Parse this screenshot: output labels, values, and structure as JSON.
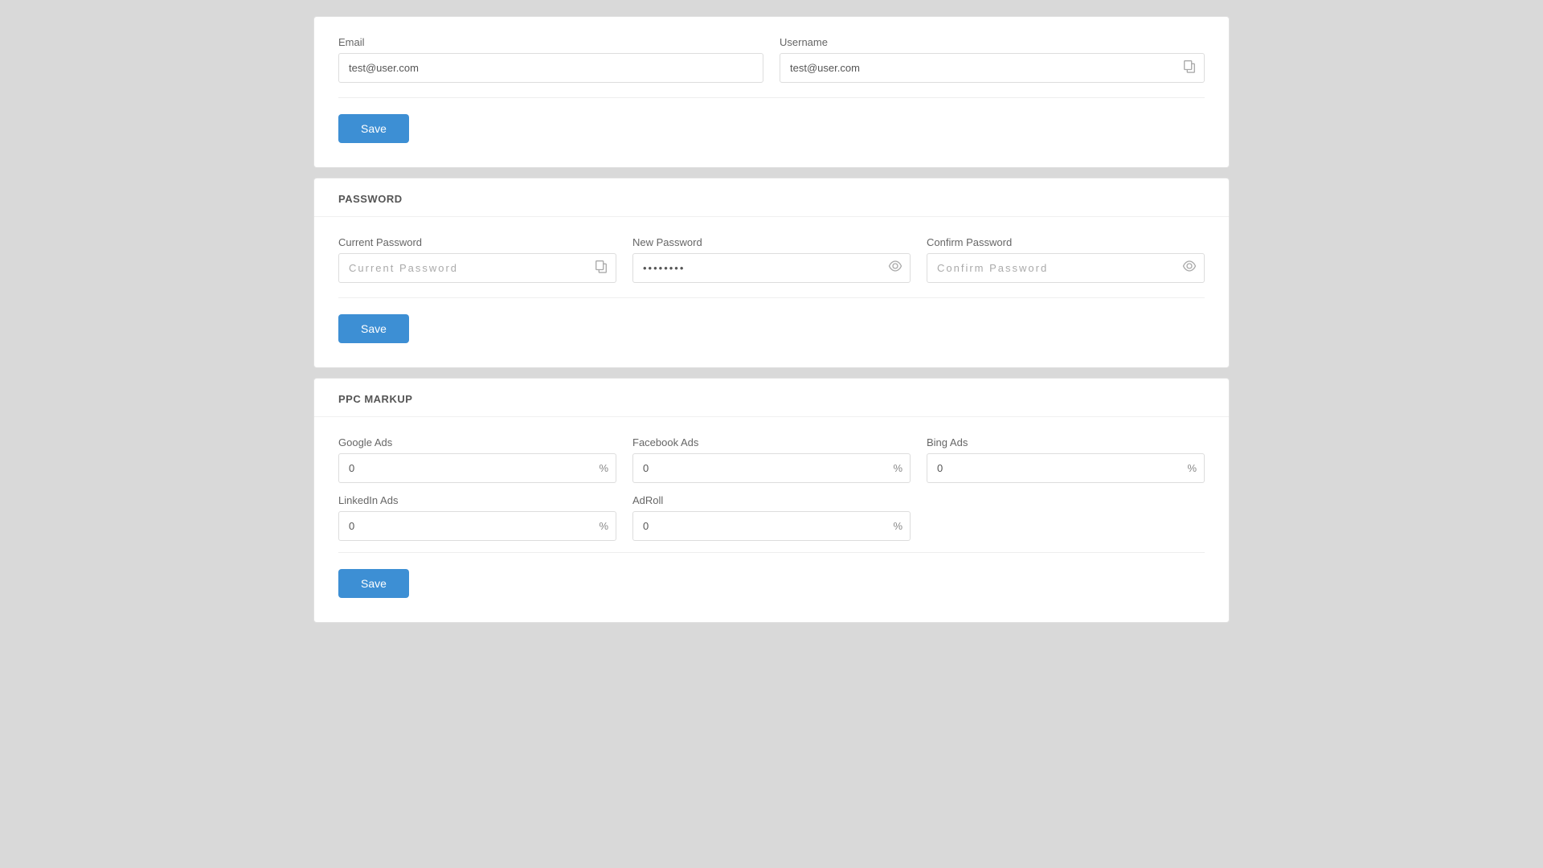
{
  "account_card": {
    "email_label": "Email",
    "email_value": "test@user.com",
    "username_label": "Username",
    "username_value": "test@user.com",
    "save_label": "Save"
  },
  "password_card": {
    "section_title": "PASSWORD",
    "current_password_label": "Current Password",
    "current_password_placeholder": "Current Password",
    "new_password_label": "New Password",
    "new_password_value": "••••••••",
    "confirm_password_label": "Confirm Password",
    "confirm_password_placeholder": "Confirm Password",
    "save_label": "Save"
  },
  "ppc_card": {
    "section_title": "PPC MARKUP",
    "google_ads_label": "Google Ads",
    "google_ads_value": "0",
    "facebook_ads_label": "Facebook Ads",
    "facebook_ads_value": "0",
    "bing_ads_label": "Bing Ads",
    "bing_ads_value": "0",
    "linkedin_ads_label": "LinkedIn Ads",
    "linkedin_ads_value": "0",
    "adroll_label": "AdRoll",
    "adroll_value": "0",
    "percent_suffix": "%",
    "save_label": "Save"
  }
}
